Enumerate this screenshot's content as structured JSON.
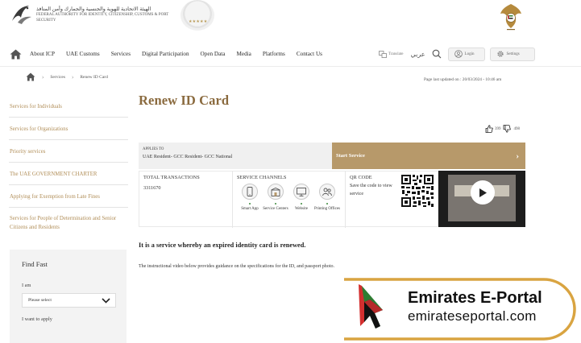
{
  "header": {
    "logo_text_ar": "الهيئة الاتحادية للهوية والجنسية والجمارك وأمن المنافذ",
    "logo_text_en": "FEDERAL AUTHORITY FOR IDENTITY, CITIZENSHIP, CUSTOMS & PORT SECURITY",
    "seal_stars": "★★★★★"
  },
  "nav": {
    "items": [
      "About ICP",
      "UAE Customs",
      "Services",
      "Digital Participation",
      "Open Data",
      "Media",
      "Platforms",
      "Contact Us"
    ],
    "translate_label": "Translate",
    "language_label": "عربي",
    "login_label": "Login",
    "settings_label": "Settings"
  },
  "breadcrumb": {
    "items": [
      "Services",
      "Renew ID Card"
    ],
    "last_updated": "Page last updated on : 20/03/2024 - 10:46 am"
  },
  "sidebar": {
    "items": [
      "Services for Individuals",
      "Services for Organizations",
      "Priority services",
      "The UAE GOVERNMENT CHARTER",
      "Applying for Exemption from Late Fines",
      "Services for People of Determination and Senior Citizens and Residents"
    ]
  },
  "find_fast": {
    "title": "Find Fast",
    "i_am_label": "I am",
    "i_am_value": "Please select",
    "apply_label": "I want to apply"
  },
  "main": {
    "title": "Renew ID Card",
    "likes": "399",
    "dislikes": "498",
    "applies_label": "APPLIES TO",
    "applies_value": "UAE Resident- GCC Resident- GCC National",
    "start_label": "Start Service",
    "transactions_label": "TOTAL TRANSACTIONS",
    "transactions_value": "3311670",
    "channels_label": "SERVICE CHANNELS",
    "channels": [
      "Smart App",
      "Service Centers",
      "Website",
      "Printing Offices"
    ],
    "qr_label": "QR CODE",
    "qr_text": "Save the code to view service",
    "description": "It is a service whereby an expired identity card is renewed.",
    "instruction": "The instructional video below provides guidance on the specifications for the ID, and passport photo."
  },
  "watermark": {
    "title": "Emirates E-Portal",
    "subtitle": "emirateseportal.com"
  },
  "colors": {
    "gold": "#b7996a",
    "title_brown": "#8a6a3e",
    "sidebar_gold": "#b08d57",
    "watermark_gold": "#d9a441"
  }
}
